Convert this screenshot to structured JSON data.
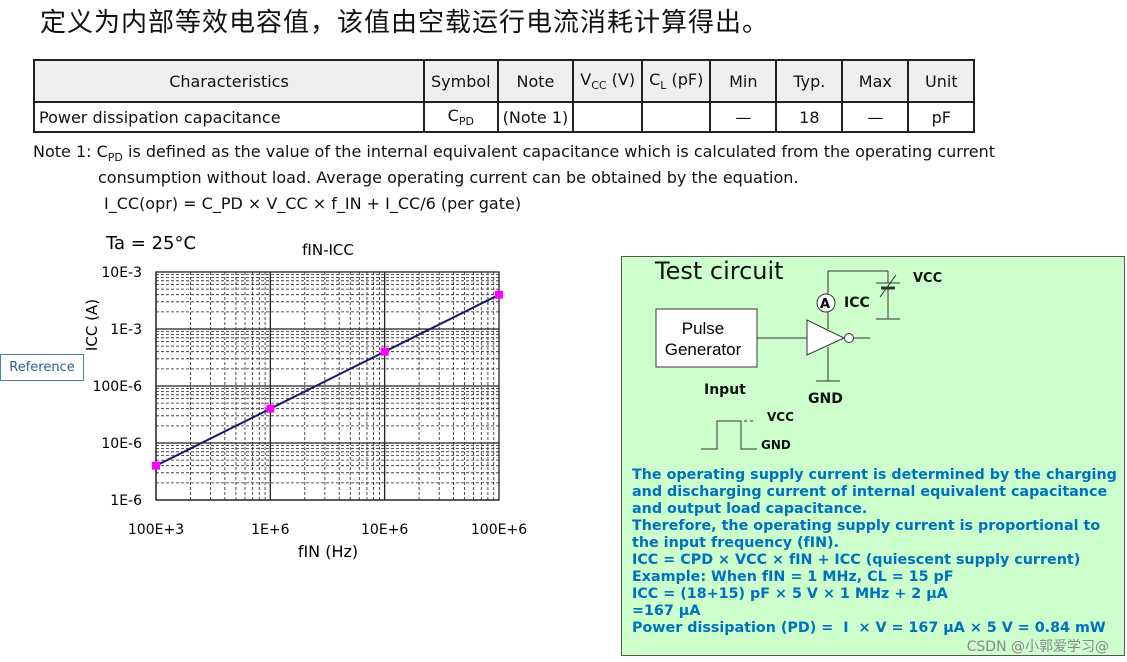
{
  "heading": "定义为内部等效电容值，该值由空载运行电流消耗计算得出。",
  "table": {
    "headers": [
      {
        "t": "Characteristics"
      },
      {
        "t": "Symbol"
      },
      {
        "t": "Note"
      },
      {
        "t": "V",
        "s": "CC",
        "e": " (V)"
      },
      {
        "t": "C",
        "s": "L",
        "e": " (pF)"
      },
      {
        "t": "Min"
      },
      {
        "t": "Typ."
      },
      {
        "t": "Max"
      },
      {
        "t": "Unit"
      }
    ],
    "row": {
      "characteristics": "Power dissipation capacitance",
      "symbol": "C",
      "symbol_sub": "PD",
      "note": "(Note 1)",
      "vcc": "",
      "cl": "",
      "min": "—",
      "typ": "18",
      "max": "—",
      "unit": "pF"
    }
  },
  "note": {
    "line1_a": "Note 1: C",
    "line1_sub": "PD",
    "line1_b": " is defined as the value of the internal equivalent capacitance which is calculated from the operating current",
    "line2": "consumption without load. Average operating current can be obtained by the equation.",
    "equation": "I_CC(opr) = C_PD × V_CC × f_IN + I_CC/6 (per gate)"
  },
  "reference_label": "Reference",
  "chart_data": {
    "type": "line",
    "title": "fIN-ICC",
    "annotation": "Ta = 25°C",
    "xlabel": "fIN (Hz)",
    "ylabel": "ICC (A)",
    "xscale": "log",
    "yscale": "log",
    "xlim": [
      100000,
      100000000
    ],
    "ylim": [
      1e-06,
      0.01
    ],
    "xticks": [
      "100E+3",
      "1E+6",
      "10E+6",
      "100E+6"
    ],
    "yticks": [
      "10E-3",
      "1E-3",
      "100E-6",
      "10E-6",
      "1E-6"
    ],
    "grid": true,
    "x": [
      100000,
      1000000,
      10000000,
      100000000
    ],
    "y": [
      4e-06,
      4e-05,
      0.0004,
      0.004
    ],
    "line_color": "#1a1a6e",
    "marker_color": "#ff00ff"
  },
  "circuit": {
    "title": "Test circuit",
    "pulse_generator": "Pulse Generator",
    "vcc": "VCC",
    "icc": "ICC",
    "ammeter": "A",
    "gnd": "GND",
    "input": "Input",
    "input_vcc": "VCC",
    "input_gnd": "GND",
    "text": "The operating supply current is determined by the charging\nand discharging current of internal equivalent capacitance\nand output load capacitance.\nTherefore, the operating supply current is proportional to\nthe input frequency (fIN).\nICC = CPD × VCC × fIN + ICC (quiescent supply current)\nExample: When fIN = 1 MHz, CL = 15 pF\nICC = (18+15) pF × 5 V × 1 MHz + 2 μA\n=167 μA\nPower dissipation (PD) =  I  × V = 167 μA × 5 V = 0.84 mW"
  },
  "watermark": "CSDN @小郭爱学习@"
}
